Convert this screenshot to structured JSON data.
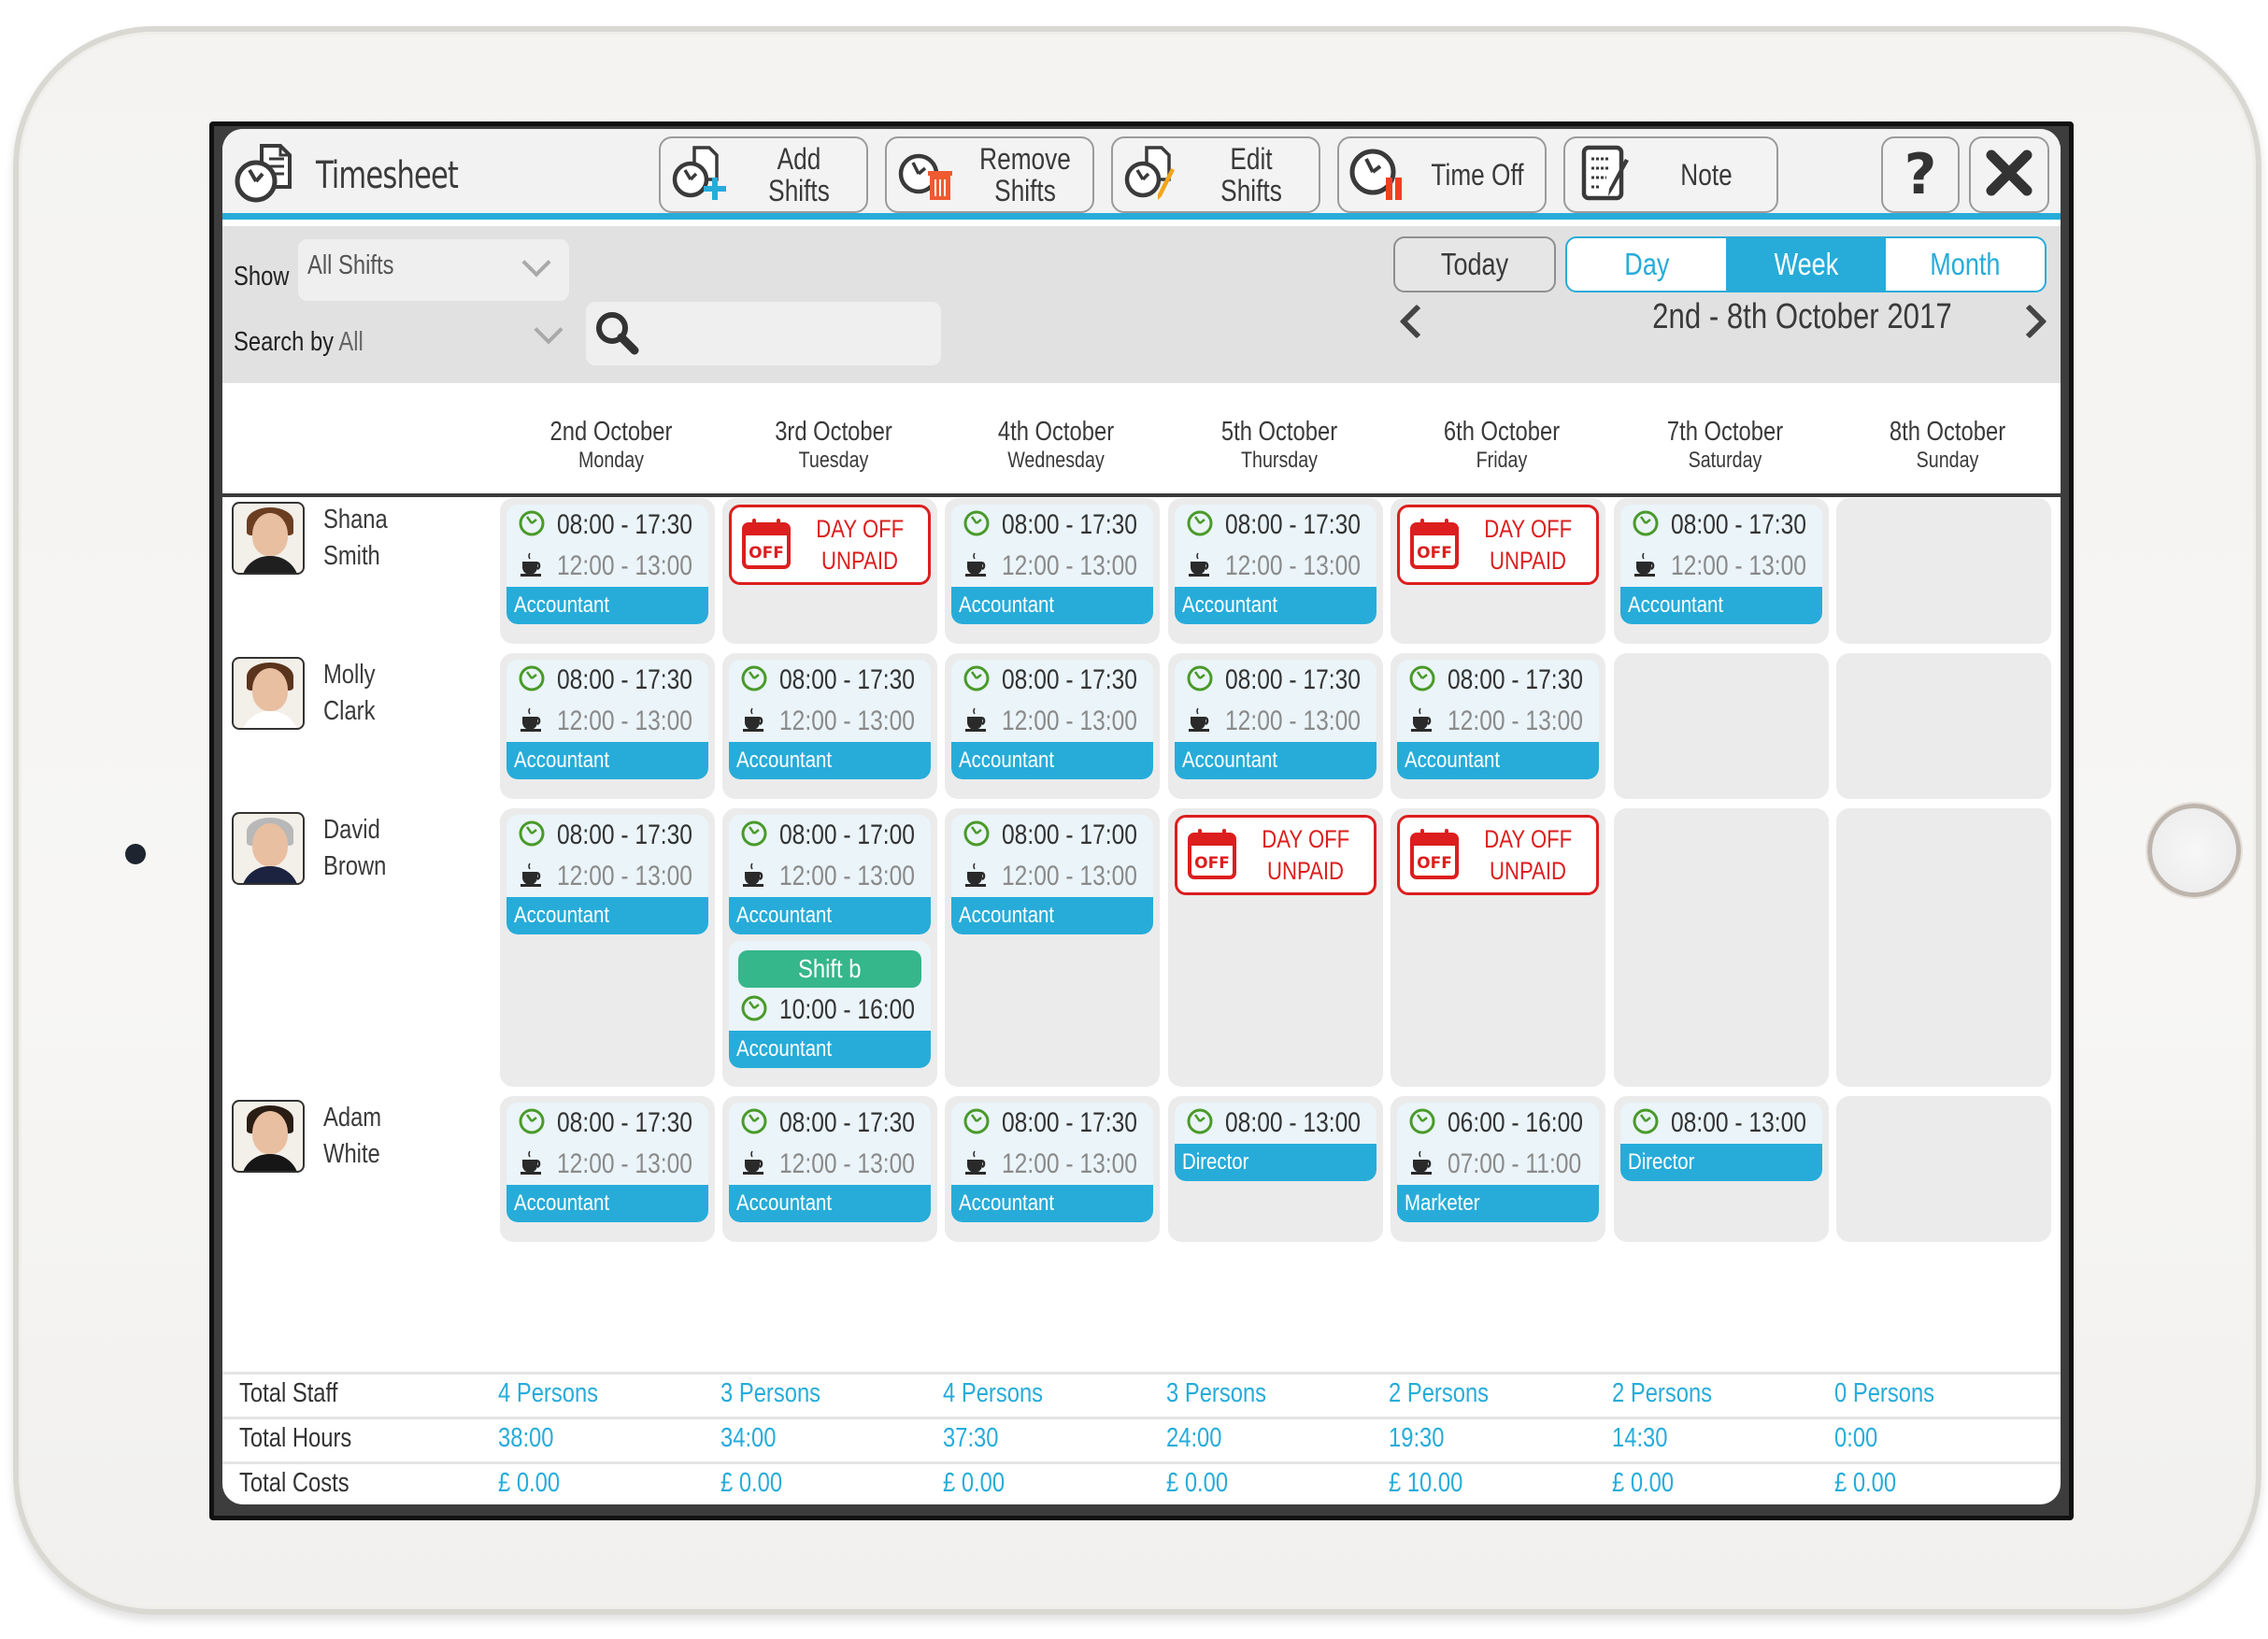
{
  "app": {
    "title": "Timesheet",
    "toolbar": {
      "add_shifts": "Add Shifts",
      "remove_shifts_line1": "Remove",
      "remove_shifts_line2": "Shifts",
      "edit_shifts": "Edit Shifts",
      "time_off": "Time Off",
      "note": "Note",
      "help_icon": "question-mark-icon",
      "close_icon": "close-x-icon"
    }
  },
  "filters": {
    "show_label": "Show",
    "show_value": "All Shifts",
    "search_by_label": "Search by",
    "search_by_value": "All",
    "search_placeholder": ""
  },
  "navigation": {
    "today": "Today",
    "views": [
      "Day",
      "Week",
      "Month"
    ],
    "active_view": "Week",
    "date_range": "2nd - 8th October 2017"
  },
  "days": [
    {
      "date": "2nd October",
      "weekday": "Monday"
    },
    {
      "date": "3rd October",
      "weekday": "Tuesday"
    },
    {
      "date": "4th October",
      "weekday": "Wednesday"
    },
    {
      "date": "5th October",
      "weekday": "Thursday"
    },
    {
      "date": "6th October",
      "weekday": "Friday"
    },
    {
      "date": "7th October",
      "weekday": "Saturday"
    },
    {
      "date": "8th October",
      "weekday": "Sunday"
    }
  ],
  "day_off": {
    "line1": "DAY OFF",
    "line2": "UNPAID",
    "badge": "OFF"
  },
  "employees": [
    {
      "first": "Shana",
      "last": "Smith",
      "cells": [
        [
          {
            "type": "shift",
            "time": "08:00 - 17:30",
            "break": "12:00 - 13:00",
            "role": "Accountant"
          }
        ],
        [
          {
            "type": "dayoff"
          }
        ],
        [
          {
            "type": "shift",
            "time": "08:00 - 17:30",
            "break": "12:00 - 13:00",
            "role": "Accountant"
          }
        ],
        [
          {
            "type": "shift",
            "time": "08:00 - 17:30",
            "break": "12:00 - 13:00",
            "role": "Accountant"
          }
        ],
        [
          {
            "type": "dayoff"
          }
        ],
        [
          {
            "type": "shift",
            "time": "08:00 - 17:30",
            "break": "12:00 - 13:00",
            "role": "Accountant"
          }
        ],
        []
      ]
    },
    {
      "first": "Molly",
      "last": "Clark",
      "cells": [
        [
          {
            "type": "shift",
            "time": "08:00 - 17:30",
            "break": "12:00 - 13:00",
            "role": "Accountant"
          }
        ],
        [
          {
            "type": "shift",
            "time": "08:00 - 17:30",
            "break": "12:00 - 13:00",
            "role": "Accountant"
          }
        ],
        [
          {
            "type": "shift",
            "time": "08:00 - 17:30",
            "break": "12:00 - 13:00",
            "role": "Accountant"
          }
        ],
        [
          {
            "type": "shift",
            "time": "08:00 - 17:30",
            "break": "12:00 - 13:00",
            "role": "Accountant"
          }
        ],
        [
          {
            "type": "shift",
            "time": "08:00 - 17:30",
            "break": "12:00 - 13:00",
            "role": "Accountant"
          }
        ],
        [],
        []
      ]
    },
    {
      "first": "David",
      "last": "Brown",
      "cells": [
        [
          {
            "type": "shift",
            "time": "08:00 - 17:30",
            "break": "12:00 - 13:00",
            "role": "Accountant"
          }
        ],
        [
          {
            "type": "shift",
            "time": "08:00 - 17:00",
            "break": "12:00 - 13:00",
            "role": "Accountant"
          },
          {
            "type": "shift",
            "name": "Shift b",
            "time": "10:00 - 16:00",
            "role": "Accountant"
          }
        ],
        [
          {
            "type": "shift",
            "time": "08:00 - 17:00",
            "break": "12:00 - 13:00",
            "role": "Accountant"
          }
        ],
        [
          {
            "type": "dayoff"
          }
        ],
        [
          {
            "type": "dayoff"
          }
        ],
        [],
        []
      ]
    },
    {
      "first": "Adam",
      "last": "White",
      "cells": [
        [
          {
            "type": "shift",
            "time": "08:00 - 17:30",
            "break": "12:00 - 13:00",
            "role": "Accountant"
          }
        ],
        [
          {
            "type": "shift",
            "time": "08:00 - 17:30",
            "break": "12:00 - 13:00",
            "role": "Accountant"
          }
        ],
        [
          {
            "type": "shift",
            "time": "08:00 - 17:30",
            "break": "12:00 - 13:00",
            "role": "Accountant"
          }
        ],
        [
          {
            "type": "shift",
            "time": "08:00 - 13:00",
            "role": "Director"
          }
        ],
        [
          {
            "type": "shift",
            "time": "06:00 - 16:00",
            "break": "07:00 - 11:00",
            "role": "Marketer"
          }
        ],
        [
          {
            "type": "shift",
            "time": "08:00 - 13:00",
            "role": "Director"
          }
        ],
        []
      ]
    }
  ],
  "totals": [
    {
      "label": "Total Staff",
      "values": [
        "4 Persons",
        "3 Persons",
        "4 Persons",
        "3 Persons",
        "2 Persons",
        "2 Persons",
        "0 Persons"
      ]
    },
    {
      "label": "Total Hours",
      "values": [
        "38:00",
        "34:00",
        "37:30",
        "24:00",
        "19:30",
        "14:30",
        "0:00"
      ]
    },
    {
      "label": "Total Costs",
      "values": [
        "£ 0.00",
        "£ 0.00",
        "£ 0.00",
        "£ 0.00",
        "£ 10.00",
        "£ 0.00",
        "£ 0.00"
      ]
    }
  ],
  "colors": {
    "accent": "#27acd9",
    "day_off": "#dc1e1e",
    "secondary_shift": "#36b68b",
    "clock_icon": "#4a9a2a"
  }
}
